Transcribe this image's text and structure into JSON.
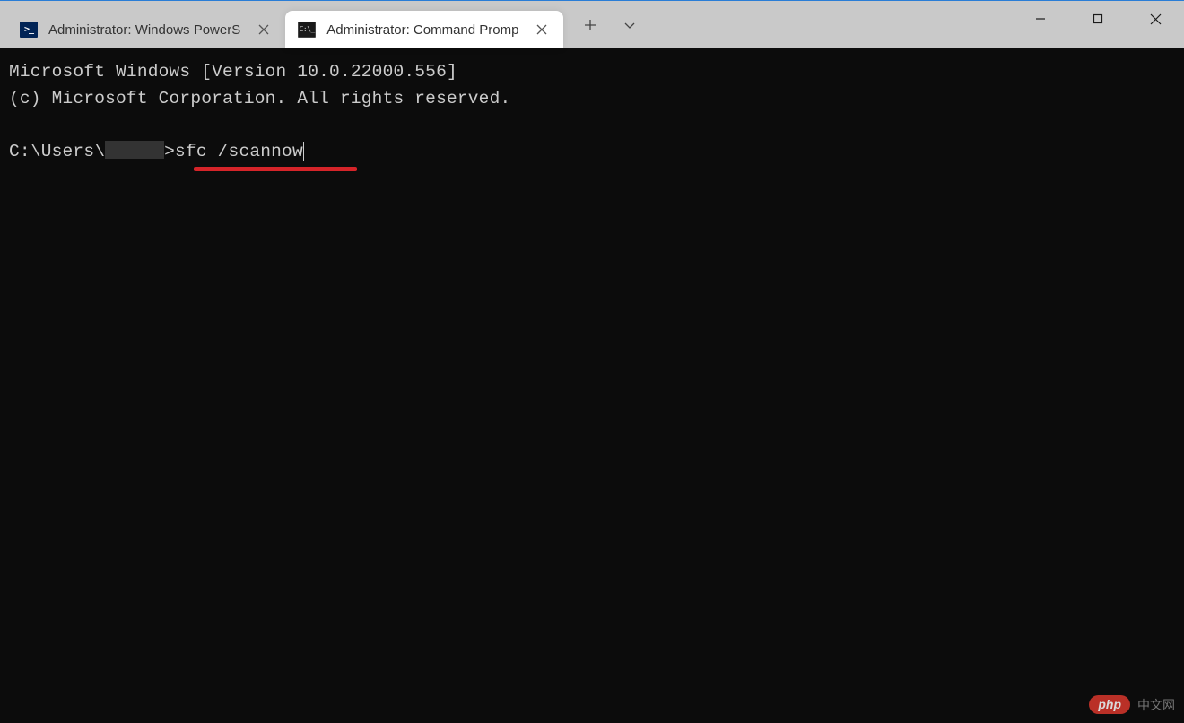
{
  "tabs": [
    {
      "title": "Administrator: Windows PowerS",
      "icon": "powershell",
      "active": false
    },
    {
      "title": "Administrator: Command Promp",
      "icon": "cmd",
      "active": true
    }
  ],
  "terminal": {
    "banner_line1": "Microsoft Windows [Version 10.0.22000.556]",
    "banner_line2": "(c) Microsoft Corporation. All rights reserved.",
    "prompt_prefix": "C:\\Users\\",
    "prompt_suffix": ">",
    "command": "sfc /scannow"
  },
  "watermark": {
    "pill": "php",
    "text": "中文网"
  }
}
